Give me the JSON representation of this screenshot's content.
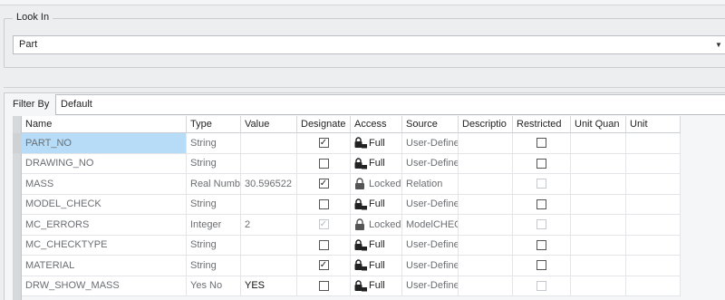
{
  "look_in": {
    "label": "Look In",
    "selected": "Part"
  },
  "filter": {
    "label": "Filter By",
    "value": "Default"
  },
  "columns": [
    "Name",
    "Type",
    "Value",
    "Designate",
    "Access",
    "Source",
    "Descriptio",
    "Restricted",
    "Unit Quan",
    "Unit"
  ],
  "rows": [
    {
      "name": "PART_NO",
      "type": "String",
      "value": "",
      "designate": "checked",
      "access_label": "Full",
      "source": "User-Define",
      "restricted": "unchecked"
    },
    {
      "name": "DRAWING_NO",
      "type": "String",
      "value": "",
      "designate": "unchecked",
      "access_label": "Full",
      "source": "User-Define",
      "restricted": "unchecked"
    },
    {
      "name": "MASS",
      "type": "Real Numb",
      "value": "30.596522",
      "designate": "checked",
      "access_label": "Locked",
      "source": "Relation",
      "restricted": "disabled"
    },
    {
      "name": "MODEL_CHECK",
      "type": "String",
      "value": "",
      "designate": "unchecked",
      "access_label": "Full",
      "source": "User-Define",
      "restricted": "unchecked"
    },
    {
      "name": "MC_ERRORS",
      "type": "Integer",
      "value": "2",
      "designate": "disabled-checked",
      "access_label": "Locked",
      "source": "ModelCHEC",
      "restricted": "disabled"
    },
    {
      "name": "MC_CHECKTYPE",
      "type": "String",
      "value": "",
      "designate": "unchecked",
      "access_label": "Full",
      "source": "User-Define",
      "restricted": "unchecked"
    },
    {
      "name": "MATERIAL",
      "type": "String",
      "value": "",
      "designate": "checked",
      "access_label": "Full",
      "source": "User-Define",
      "restricted": "unchecked"
    },
    {
      "name": "DRW_SHOW_MASS",
      "type": "Yes No",
      "value": "YES",
      "designate": "unchecked",
      "access_label": "Full",
      "source": "User-Define",
      "restricted": "disabled"
    }
  ],
  "icons": {
    "access_full": "lock-open-icon",
    "access_locked": "lock-icon",
    "dropdown": "chevron-down-icon"
  }
}
